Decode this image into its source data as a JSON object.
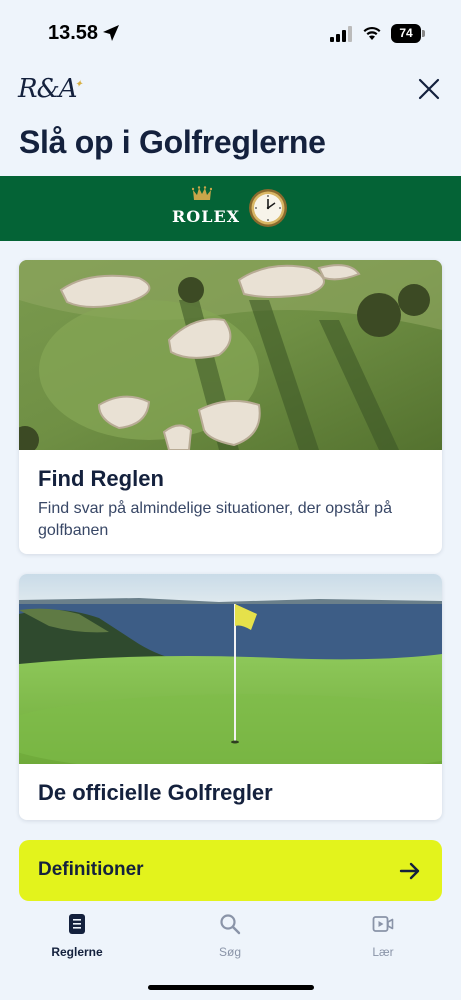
{
  "status_bar": {
    "time": "13.58",
    "battery": "74",
    "icons": [
      "location-arrow-icon",
      "signal-icon",
      "wifi-icon",
      "battery-icon"
    ]
  },
  "header": {
    "logo": "R&A",
    "close_icon": "close-icon"
  },
  "page": {
    "title": "Slå op i Golfreglerne"
  },
  "sponsor": {
    "name": "ROLEX",
    "background_color": "#046336"
  },
  "cards": [
    {
      "title": "Find Reglen",
      "description": "Find svar på almindelige situationer, der opstår på golfbanen",
      "image": "aerial-golf-course-bunkers"
    },
    {
      "title": "De officielle Golfregler",
      "image": "golf-green-flag-by-sea"
    }
  ],
  "definitions_button": {
    "label": "Definitioner",
    "icon": "arrow-right-icon",
    "color": "#e3f31c"
  },
  "tabs": [
    {
      "label": "Reglerne",
      "icon": "book-icon",
      "active": true
    },
    {
      "label": "Søg",
      "icon": "search-icon",
      "active": false
    },
    {
      "label": "Lær",
      "icon": "video-icon",
      "active": false
    }
  ],
  "colors": {
    "primary": "#14213d",
    "background": "#eef4fb",
    "accent": "#e3f31c",
    "sponsor_green": "#046336"
  }
}
